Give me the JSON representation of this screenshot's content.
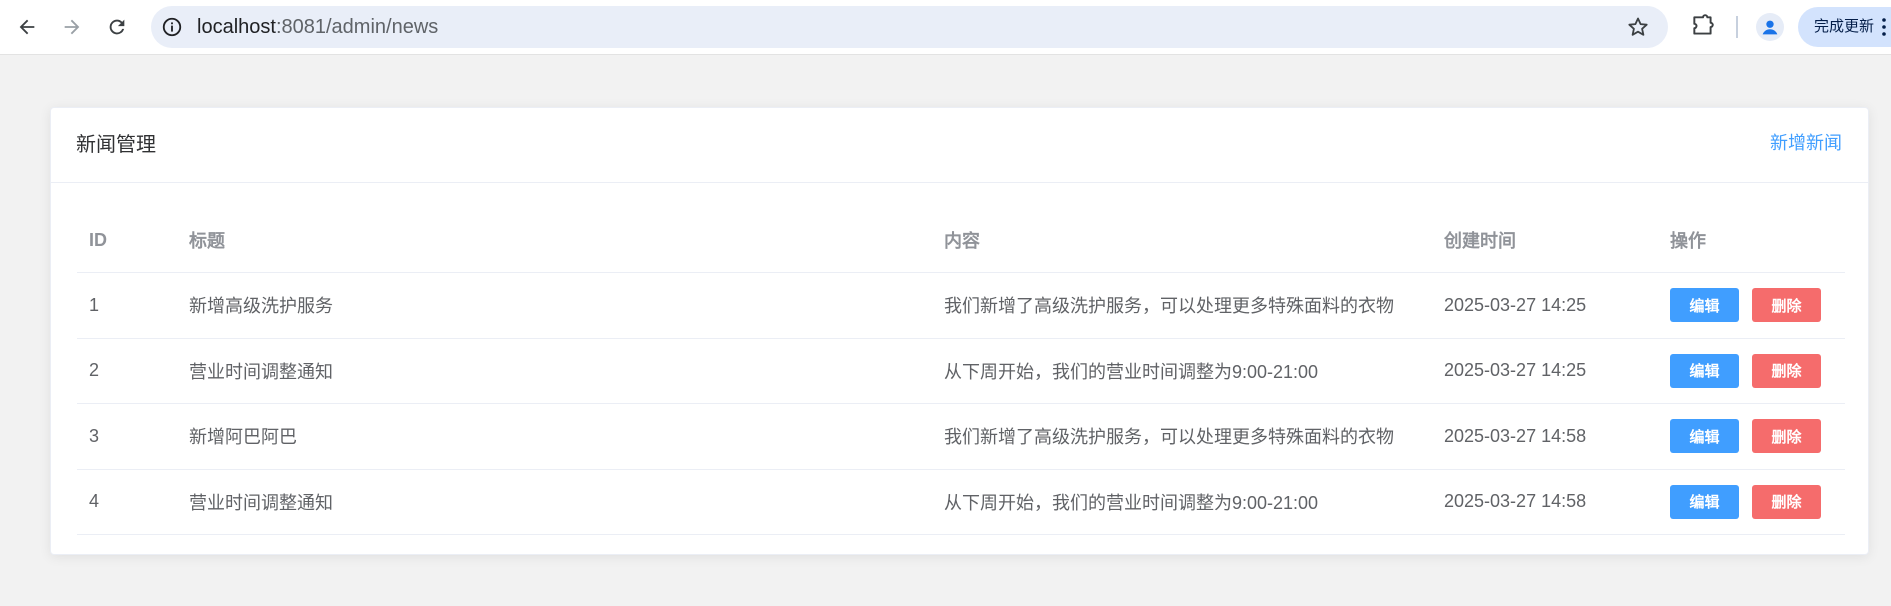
{
  "browser": {
    "url_host": "localhost",
    "url_path": ":8081/admin/news",
    "update_label": "完成更新",
    "icons": {
      "back": "arrow-left-icon",
      "forward": "arrow-right-icon",
      "reload": "reload-icon",
      "info": "info-icon",
      "star": "star-icon",
      "extensions": "puzzle-icon",
      "profile": "person-icon",
      "menu": "kebab-menu-icon"
    }
  },
  "card": {
    "title": "新闻管理",
    "add_label": "新增新闻"
  },
  "table": {
    "headers": {
      "id": "ID",
      "title": "标题",
      "content": "内容",
      "created": "创建时间",
      "ops": "操作"
    },
    "rows": [
      {
        "id": "1",
        "title": "新增高级洗护服务",
        "content": "我们新增了高级洗护服务，可以处理更多特殊面料的衣物",
        "created": "2025-03-27 14:25",
        "edit": "编辑",
        "delete": "删除"
      },
      {
        "id": "2",
        "title": "营业时间调整通知",
        "content": "从下周开始，我们的营业时间调整为9:00-21:00",
        "created": "2025-03-27 14:25",
        "edit": "编辑",
        "delete": "删除"
      },
      {
        "id": "3",
        "title": "新增阿巴阿巴",
        "content": "我们新增了高级洗护服务，可以处理更多特殊面料的衣物",
        "created": "2025-03-27 14:58",
        "edit": "编辑",
        "delete": "删除"
      },
      {
        "id": "4",
        "title": "营业时间调整通知",
        "content": "从下周开始，我们的营业时间调整为9:00-21:00",
        "created": "2025-03-27 14:58",
        "edit": "编辑",
        "delete": "删除"
      }
    ]
  },
  "colors": {
    "primary": "#409eff",
    "danger": "#f56c6c",
    "background": "#f2f2f2"
  }
}
